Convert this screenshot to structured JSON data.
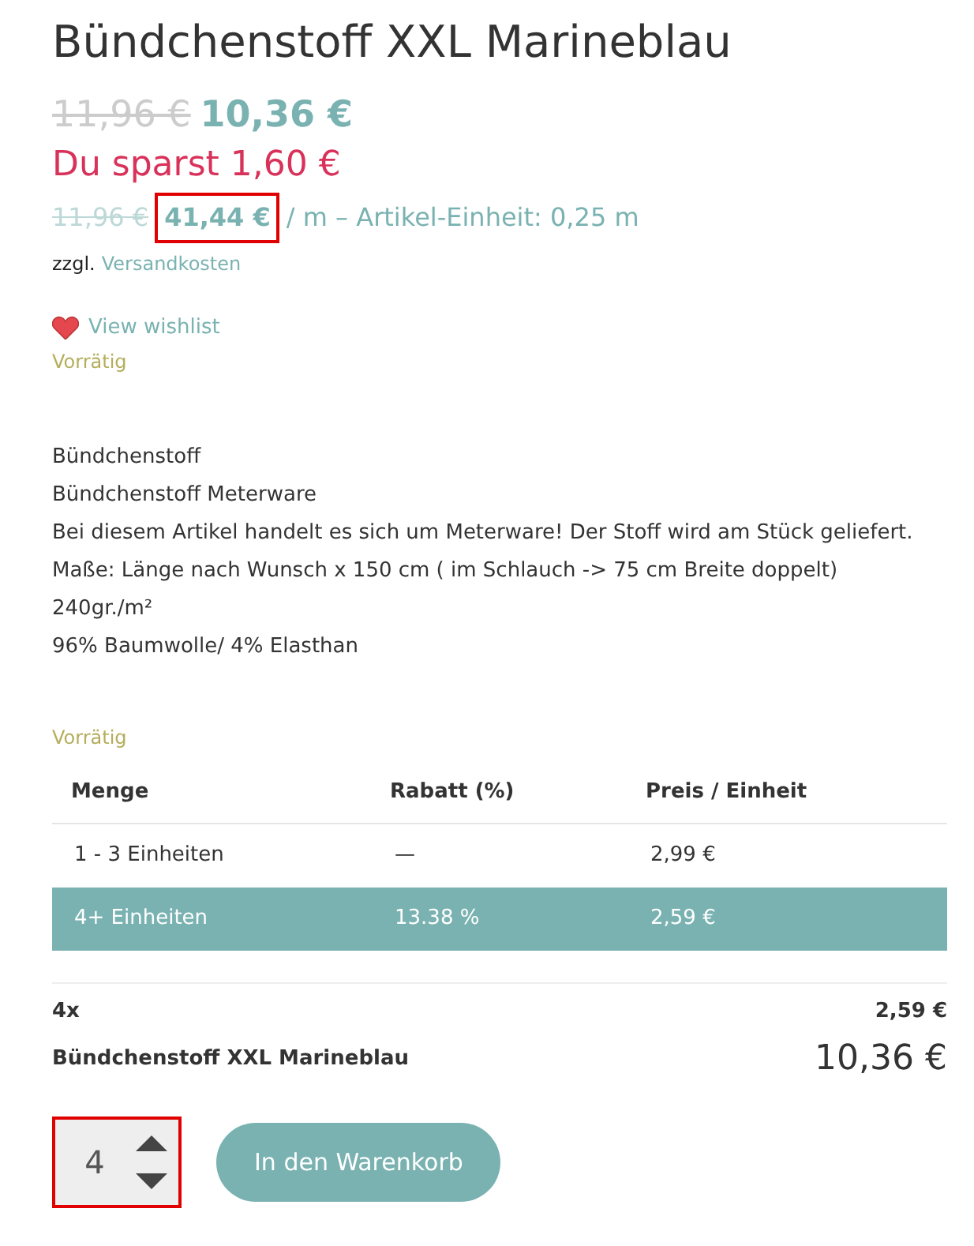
{
  "title": "Bündchenstoff XXL Marineblau",
  "price": {
    "old": "11,96 €",
    "new": "10,36 €"
  },
  "savings": "Du sparst 1,60 €",
  "unit_price": {
    "old": "11,96 €",
    "new": "41,44 €",
    "highlighted": true,
    "rest": "/ m – Artikel-Einheit: 0,25 m"
  },
  "shipping": {
    "prefix": "zzgl.",
    "link": "Versandkosten"
  },
  "wishlist": "View wishlist",
  "stock_top": "Vorrätig",
  "description": [
    "Bündchenstoff",
    "Bündchenstoff Meterware",
    "Bei diesem Artikel handelt es sich um Meterware! Der Stoff wird am Stück geliefert.",
    "Maße: Länge nach Wunsch x 150 cm ( im Schlauch -> 75 cm Breite doppelt)",
    "240gr./m²",
    "96% Baumwolle/ 4% Elasthan"
  ],
  "stock": "Vorrätig",
  "table": {
    "columns": [
      "Menge",
      "Rabatt (%)",
      "Preis / Einheit"
    ],
    "rows": [
      {
        "cells": [
          "1 - 3 Einheiten",
          "—",
          "2,99 €"
        ],
        "selected": false
      },
      {
        "cells": [
          "4+ Einheiten",
          "13.38 %",
          "2,59 €"
        ],
        "selected": true
      }
    ]
  },
  "summary": {
    "quantity": "4x",
    "unit_price": "2,59 €",
    "product": "Bündchenstoff XXL Marineblau",
    "total": "10,36 €"
  },
  "quantity_field": {
    "value": "4",
    "highlighted": true
  },
  "cart_button": "In den Warenkorb"
}
